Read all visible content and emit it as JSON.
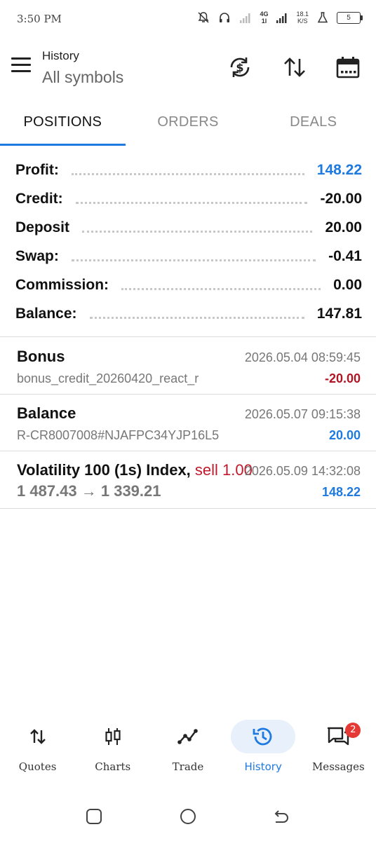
{
  "status_bar": {
    "time": "3:50 PM",
    "network_type": "4G",
    "network_sub": "1l",
    "speed_value": "18.1",
    "speed_unit": "K/S",
    "battery": "5"
  },
  "header": {
    "title": "History",
    "subtitle": "All symbols"
  },
  "tabs": [
    {
      "label": "POSITIONS",
      "active": true
    },
    {
      "label": "ORDERS",
      "active": false
    },
    {
      "label": "DEALS",
      "active": false
    }
  ],
  "summary": [
    {
      "label": "Profit:",
      "value": "148.22"
    },
    {
      "label": "Credit:",
      "value": "-20.00"
    },
    {
      "label": "Deposit",
      "value": "20.00"
    },
    {
      "label": "Swap:",
      "value": "-0.41"
    },
    {
      "label": "Commission:",
      "value": "0.00"
    },
    {
      "label": "Balance:",
      "value": "147.81"
    }
  ],
  "deals": [
    {
      "title": "Bonus",
      "side": "",
      "time": "2026.05.04 08:59:45",
      "sub": "bonus_credit_20260420_react_r",
      "amount": "-20.00"
    },
    {
      "title": "Balance",
      "side": "",
      "time": "2026.05.07 09:15:38",
      "sub": "R-CR8007008#NJAFPC34YJP16L5",
      "amount": "20.00"
    },
    {
      "title": "Volatility 100 (1s) Index,",
      "side": "sell 1.00",
      "time": "2026.05.09 14:32:08",
      "sub": "1 487.43 → 1 339.21",
      "amount": "148.22"
    }
  ],
  "bottom_nav": [
    {
      "label": "Quotes",
      "icon": "quotes-icon"
    },
    {
      "label": "Charts",
      "icon": "charts-icon"
    },
    {
      "label": "Trade",
      "icon": "trade-icon"
    },
    {
      "label": "History",
      "icon": "history-icon"
    },
    {
      "label": "Messages",
      "icon": "messages-icon",
      "badge": "2"
    }
  ],
  "colors": {
    "accent": "#1e7ae0",
    "negative": "#b01525",
    "active_nav_bg": "#e7f0fb"
  }
}
